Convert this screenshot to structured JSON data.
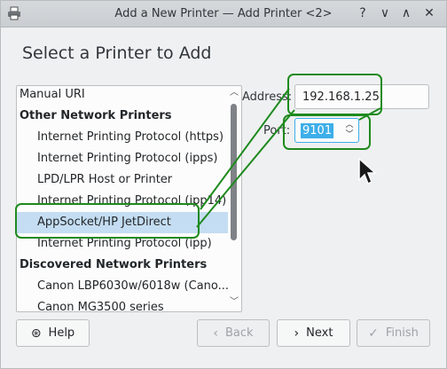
{
  "window": {
    "title": "Add a New Printer — Add Printer <2>",
    "help_glyph": "?",
    "minimize_glyph": "∨",
    "maximize_glyph": "∧",
    "close_glyph": "✕"
  },
  "page": {
    "heading": "Select a Printer to Add"
  },
  "list": {
    "items": [
      {
        "label": "Manual URI",
        "kind": "plain"
      },
      {
        "label": "Other Network Printers",
        "kind": "group"
      },
      {
        "label": "Internet Printing Protocol (https)",
        "kind": "child"
      },
      {
        "label": "Internet Printing Protocol (ipps)",
        "kind": "child"
      },
      {
        "label": "LPD/LPR Host or Printer",
        "kind": "child"
      },
      {
        "label": "Internet Printing Protocol (ipp14)",
        "kind": "child"
      },
      {
        "label": "AppSocket/HP JetDirect",
        "kind": "child",
        "selected": true
      },
      {
        "label": "Internet Printing Protocol (ipp)",
        "kind": "child"
      },
      {
        "label": "Discovered Network Printers",
        "kind": "group"
      },
      {
        "label": "Canon LBP6030w/6018w (Cano...",
        "kind": "child"
      },
      {
        "label": "Canon MG3500 series",
        "kind": "child"
      }
    ]
  },
  "form": {
    "address_label": "Address:",
    "address_value": "192.168.1.25",
    "port_label": "Port:",
    "port_value": "9101"
  },
  "buttons": {
    "help": "Help",
    "back": "Back",
    "next": "Next",
    "finish": "Finish"
  },
  "colors": {
    "annotation_green": "#1e8a1e",
    "selection": "#c4ddf2",
    "focus": "#3daee9"
  }
}
